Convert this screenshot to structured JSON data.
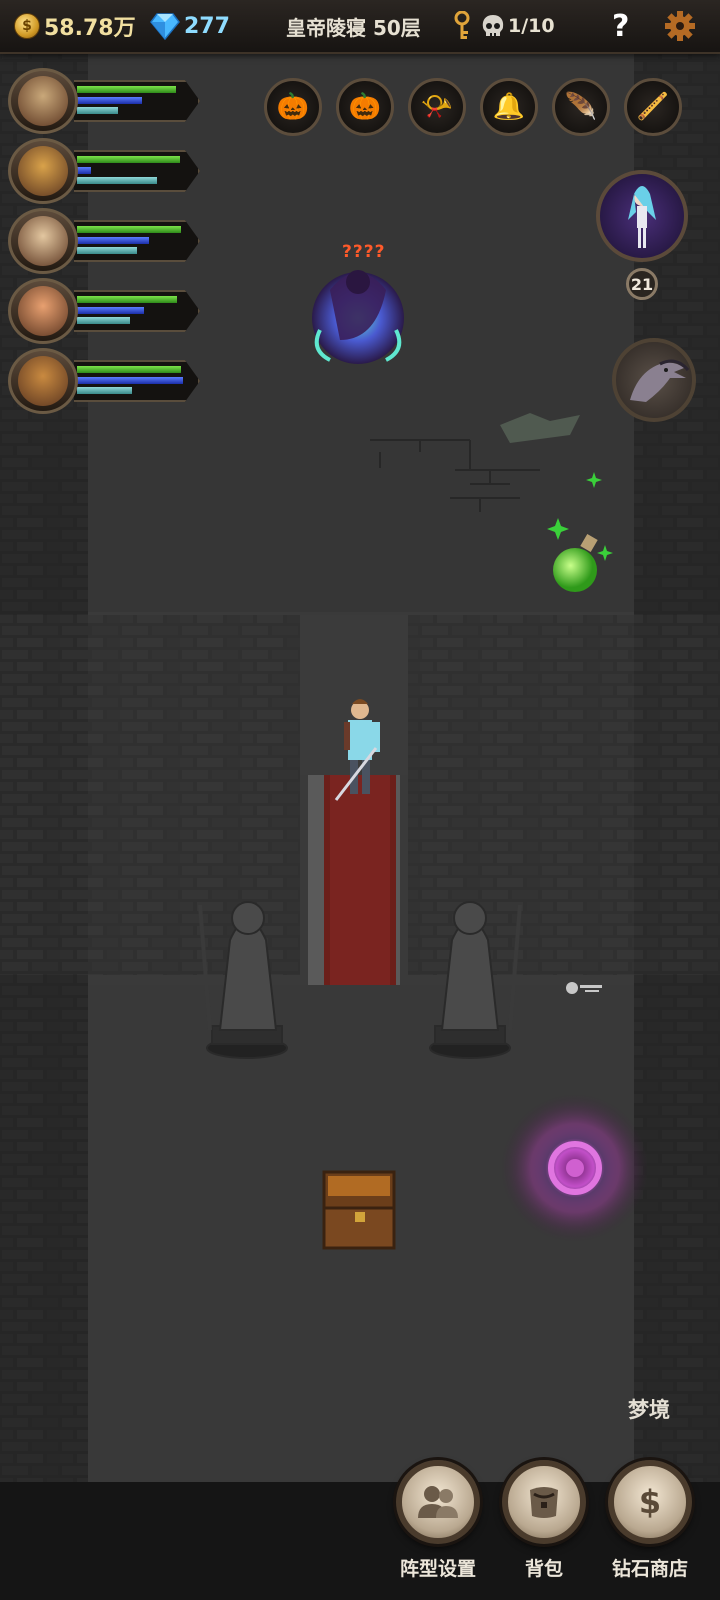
{
  "top_bar": {
    "gold": "58.78万",
    "gold_icon": "gold-coin-icon",
    "coin_symbol": "$",
    "gems": "277",
    "gem_icon": "diamond-icon",
    "location": "皇帝陵寝 50层",
    "key_icon": "key-icon",
    "kill_progress": "1/10",
    "skull_icon": "skull-icon",
    "help_symbol": "?",
    "settings_icon": "gear-icon"
  },
  "heroes": [
    {
      "name": "hero-1",
      "face": "#c9a87a",
      "hp": 0.92,
      "mp": 0.6,
      "xp": 0.38
    },
    {
      "name": "hero-2",
      "face": "#d9a24a",
      "hp": 0.95,
      "mp": 0.13,
      "xp": 0.74
    },
    {
      "name": "hero-3",
      "face": "#e3c7a0",
      "hp": 0.96,
      "mp": 0.67,
      "xp": 0.56
    },
    {
      "name": "hero-4",
      "face": "#e8a070",
      "hp": 0.93,
      "mp": 0.62,
      "xp": 0.49
    },
    {
      "name": "hero-5",
      "face": "#c98a40",
      "hp": 0.96,
      "mp": 0.98,
      "xp": 0.51
    }
  ],
  "items": [
    {
      "icon": "jack-o-lantern-red-icon",
      "glyph": "🎃",
      "color": "#e64b1c"
    },
    {
      "icon": "jack-o-lantern-icon",
      "glyph": "🎃",
      "color": "#f29a2e"
    },
    {
      "icon": "horn-icon",
      "glyph": "📯",
      "color": "#c98a4a"
    },
    {
      "icon": "bell-icon",
      "glyph": "🔔",
      "color": "#d8b04a"
    },
    {
      "icon": "feather-icon",
      "glyph": "🪶",
      "color": "#f2c23a"
    },
    {
      "icon": "flute-icon",
      "glyph": "🪈",
      "color": "#c9a46a"
    }
  ],
  "enemy": {
    "name": "????"
  },
  "summon": {
    "level": "21",
    "icon": "summon-spirit-icon"
  },
  "crow_icon": "crow-skill-icon",
  "dream_label": "梦境",
  "bottom_menu": [
    {
      "key": "formation",
      "label": "阵型设置",
      "icon": "formation-icon"
    },
    {
      "key": "bag",
      "label": "背包",
      "icon": "backpack-icon"
    },
    {
      "key": "shop",
      "label": "钻石商店",
      "icon": "diamond-shop-icon",
      "glyph": "$"
    }
  ],
  "colors": {
    "hp": "#5ccf32",
    "mp": "#3a56e0",
    "xp": "#6ab8b8",
    "enemy_name": "#ff5a2a",
    "gem": "#8fdcff"
  }
}
